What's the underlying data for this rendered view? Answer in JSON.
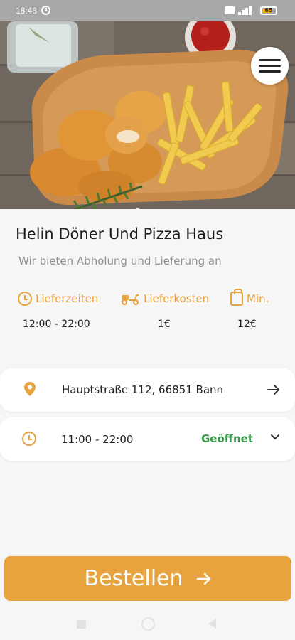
{
  "status_bar": {
    "time": "18:48",
    "battery": "65"
  },
  "hero": {
    "slides": 2,
    "active_slide": 1,
    "menu_icon": "hamburger-icon"
  },
  "restaurant": {
    "name": "Helin Döner Und Pizza Haus",
    "tagline": "Wir bieten Abholung und Lieferung an"
  },
  "info": {
    "delivery_times_label": "Lieferzeiten",
    "delivery_times_value": "12:00 - 22:00",
    "delivery_cost_label": "Lieferkosten",
    "delivery_cost_value": "1€",
    "min_label": "Min.",
    "min_value": "12€"
  },
  "address_card": {
    "address": "Hauptstraße 112, 66851 Bann",
    "icon": "location-pin-icon"
  },
  "hours_card": {
    "hours": "11:00 - 22:00",
    "status": "Geöffnet"
  },
  "order_button": {
    "label": "Bestellen"
  },
  "colors": {
    "accent": "#e7a33e",
    "open_status": "#3a9a4b"
  }
}
